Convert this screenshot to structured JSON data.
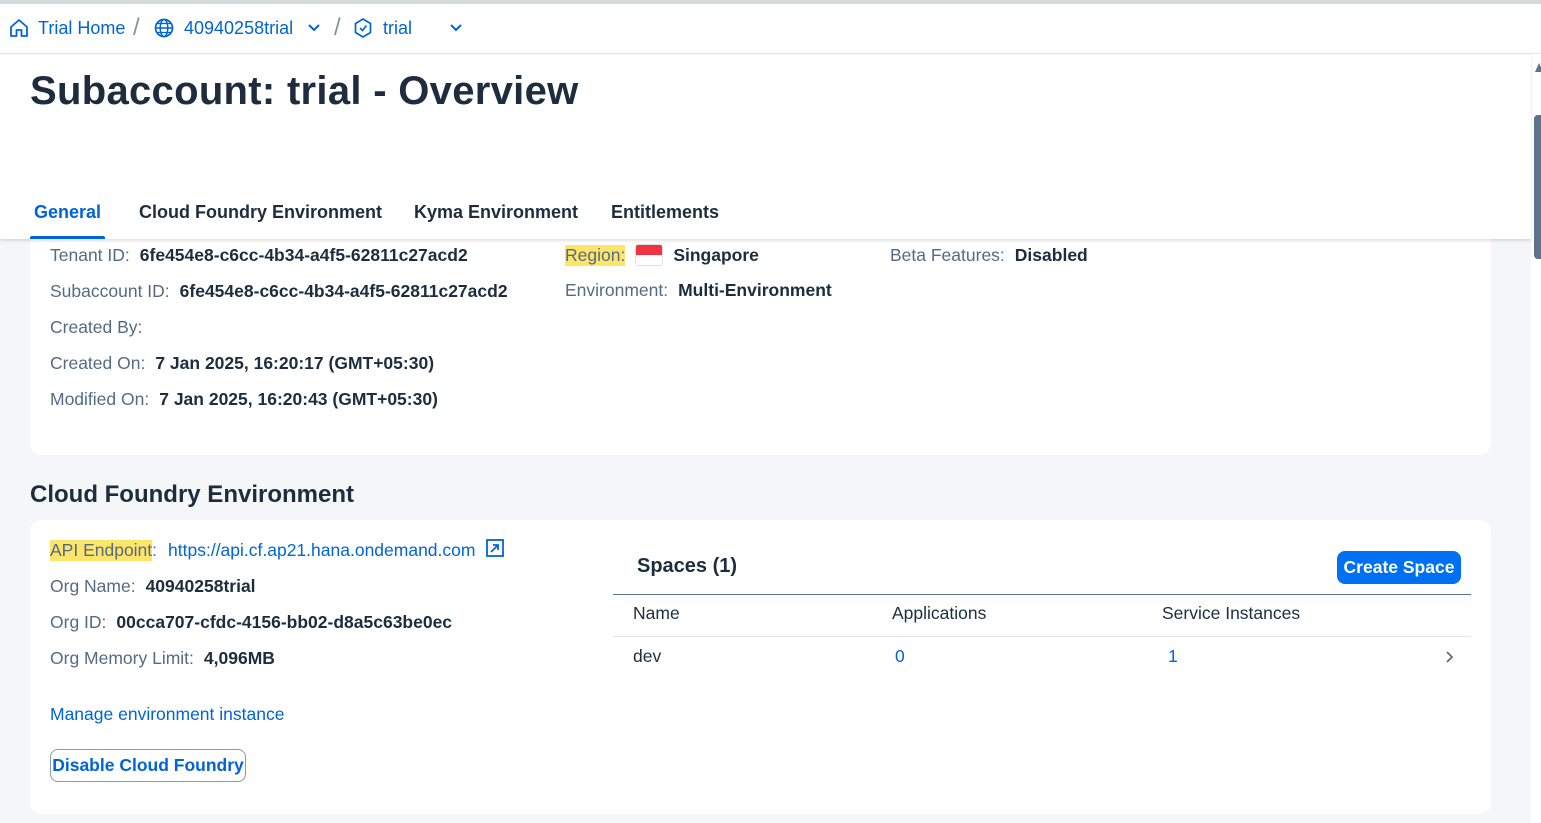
{
  "breadcrumb": {
    "home": "Trial Home",
    "global_account": "40940258trial",
    "subaccount": "trial"
  },
  "page": {
    "title": "Subaccount: trial - Overview"
  },
  "tabs": [
    {
      "label": "General",
      "active": true
    },
    {
      "label": "Cloud Foundry Environment",
      "active": false
    },
    {
      "label": "Kyma Environment",
      "active": false
    },
    {
      "label": "Entitlements",
      "active": false
    }
  ],
  "general": {
    "tenant_id_label": "Tenant ID:",
    "tenant_id": "6fe454e8-c6cc-4b34-a4f5-62811c27acd2",
    "subaccount_id_label": "Subaccount ID:",
    "subaccount_id": "6fe454e8-c6cc-4b34-a4f5-62811c27acd2",
    "created_by_label": "Created By:",
    "created_on_label": "Created On:",
    "created_on": "7 Jan 2025, 16:20:17 (GMT+05:30)",
    "modified_on_label": "Modified On:",
    "modified_on": "7 Jan 2025, 16:20:43 (GMT+05:30)",
    "region_label": "Region:",
    "region": "Singapore",
    "environment_label": "Environment:",
    "environment": "Multi-Environment",
    "beta_label": "Beta Features:",
    "beta": "Disabled"
  },
  "cf": {
    "section_title": "Cloud Foundry Environment",
    "api_endpoint_label": "API Endpoint",
    "api_endpoint_colon": ":",
    "api_endpoint": "https://api.cf.ap21.hana.ondemand.com",
    "org_name_label": "Org Name:",
    "org_name": "40940258trial",
    "org_id_label": "Org ID:",
    "org_id": "00cca707-cfdc-4156-bb02-d8a5c63be0ec",
    "org_memory_label": "Org Memory Limit:",
    "org_memory": "4,096MB",
    "manage_link": "Manage environment instance",
    "disable_button": "Disable Cloud Foundry"
  },
  "spaces": {
    "title": "Spaces (1)",
    "create_button": "Create Space",
    "columns": [
      "Name",
      "Applications",
      "Service Instances"
    ],
    "rows": [
      {
        "name": "dev",
        "applications": "0",
        "service_instances": "1"
      }
    ]
  },
  "colors": {
    "accent": "#0064d9",
    "primary_button": "#0070f2",
    "highlight": "#fde56b"
  }
}
